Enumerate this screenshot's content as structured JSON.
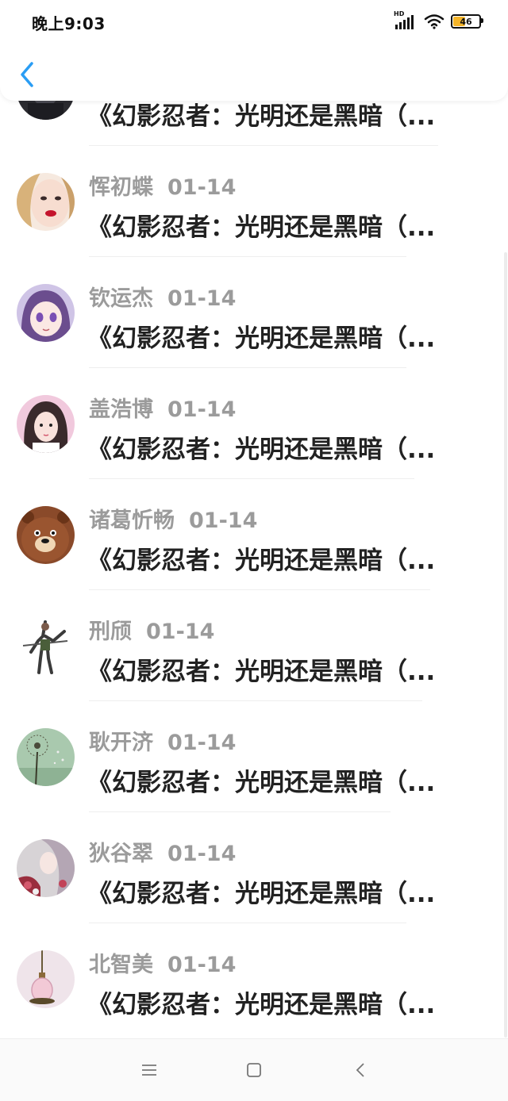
{
  "status_bar": {
    "time": "晚上9:03",
    "network_label": "HD",
    "battery": "46",
    "battery_color": "#f5b52a"
  },
  "nav": {
    "back_icon": "chevron-left-icon",
    "accent": "#2a9df4"
  },
  "list": {
    "items": [
      {
        "name": "",
        "date": "",
        "title": "《幻影忍者：光明还是黑暗（...",
        "avatar": "avatar-dark"
      },
      {
        "name": "恽初蝶",
        "date": "01-14",
        "title": "《幻影忍者：光明还是黑暗（...",
        "avatar": "avatar-girl-red-lips"
      },
      {
        "name": "钦运杰",
        "date": "01-14",
        "title": "《幻影忍者：光明还是黑暗（...",
        "avatar": "avatar-anime-purple"
      },
      {
        "name": "盖浩博",
        "date": "01-14",
        "title": "《幻影忍者：光明还是黑暗（...",
        "avatar": "avatar-girl-pink"
      },
      {
        "name": "诸葛忻畅",
        "date": "01-14",
        "title": "《幻影忍者：光明还是黑暗（...",
        "avatar": "avatar-bear"
      },
      {
        "name": "刑颀",
        "date": "01-14",
        "title": "《幻影忍者：光明还是黑暗（...",
        "avatar": "avatar-warrior"
      },
      {
        "name": "耿开济",
        "date": "01-14",
        "title": "《幻影忍者：光明还是黑暗（...",
        "avatar": "avatar-dandelion"
      },
      {
        "name": "狄谷翠",
        "date": "01-14",
        "title": "《幻影忍者：光明还是黑暗（...",
        "avatar": "avatar-art-flowers"
      },
      {
        "name": "北智美",
        "date": "01-14",
        "title": "《幻影忍者：光明还是黑暗（...",
        "avatar": "avatar-pendant"
      }
    ]
  },
  "bottom_nav": {
    "menu_icon": "menu-icon",
    "home_icon": "home-square-icon",
    "back_icon": "back-triangle-icon"
  }
}
